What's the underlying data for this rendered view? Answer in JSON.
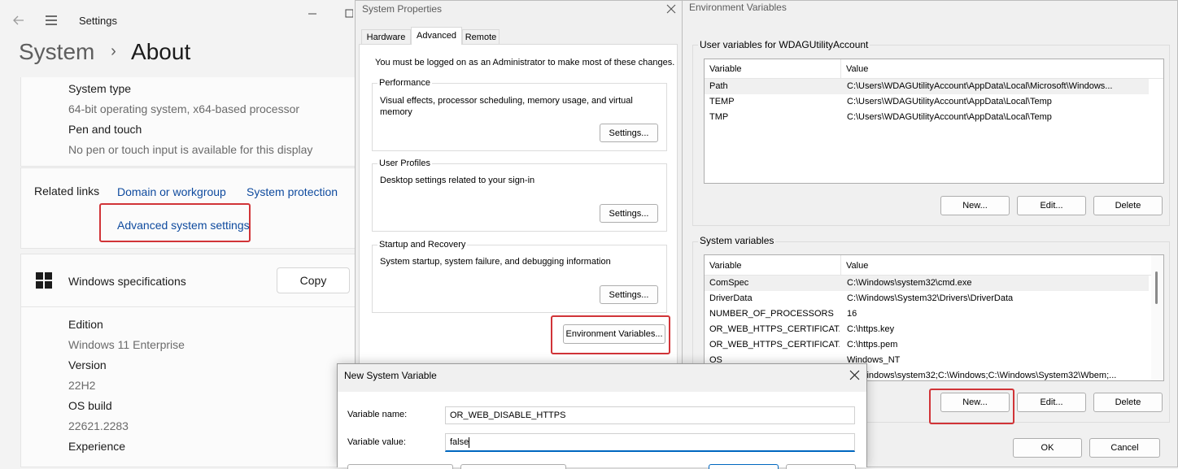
{
  "settings": {
    "app_title": "Settings",
    "breadcrumb_parent": "System",
    "breadcrumb_sep": "›",
    "breadcrumb_current": "About",
    "system_type_label": "System type",
    "system_type_value": "64-bit operating system, x64-based processor",
    "pen_touch_label": "Pen and touch",
    "pen_touch_value": "No pen or touch input is available for this display",
    "related_links_label": "Related links",
    "link_domain": "Domain or workgroup",
    "link_protection": "System protection",
    "link_advanced": "Advanced system settings",
    "win_spec_title": "Windows specifications",
    "copy_label": "Copy",
    "edition_label": "Edition",
    "edition_value": "Windows 11 Enterprise",
    "version_label": "Version",
    "version_value": "22H2",
    "osbuild_label": "OS build",
    "osbuild_value": "22621.2283",
    "experience_label": "Experience"
  },
  "sysprops": {
    "title": "System Properties",
    "tabs": [
      "Hardware",
      "Advanced",
      "Remote"
    ],
    "admin_note": "You must be logged on as an Administrator to make most of these changes.",
    "perf_label": "Performance",
    "perf_desc": "Visual effects, processor scheduling, memory usage, and virtual memory",
    "profiles_label": "User Profiles",
    "profiles_desc": "Desktop settings related to your sign-in",
    "startup_label": "Startup and Recovery",
    "startup_desc": "System startup, system failure, and debugging information",
    "settings_btn": "Settings...",
    "env_btn": "Environment Variables..."
  },
  "envvars": {
    "title": "Environment Variables",
    "user_group": "User variables for WDAGUtilityAccount",
    "col_variable": "Variable",
    "col_value": "Value",
    "user_rows": [
      {
        "name": "Path",
        "value": "C:\\Users\\WDAGUtilityAccount\\AppData\\Local\\Microsoft\\Windows..."
      },
      {
        "name": "TEMP",
        "value": "C:\\Users\\WDAGUtilityAccount\\AppData\\Local\\Temp"
      },
      {
        "name": "TMP",
        "value": "C:\\Users\\WDAGUtilityAccount\\AppData\\Local\\Temp"
      }
    ],
    "system_group": "System variables",
    "system_rows": [
      {
        "name": "ComSpec",
        "value": "C:\\Windows\\system32\\cmd.exe"
      },
      {
        "name": "DriverData",
        "value": "C:\\Windows\\System32\\Drivers\\DriverData"
      },
      {
        "name": "NUMBER_OF_PROCESSORS",
        "value": "16"
      },
      {
        "name": "OR_WEB_HTTPS_CERTIFICAT...",
        "value": "C:\\https.key"
      },
      {
        "name": "OR_WEB_HTTPS_CERTIFICAT...",
        "value": "C:\\https.pem"
      },
      {
        "name": "OS",
        "value": "Windows_NT"
      },
      {
        "name": "",
        "value": "C:\\Windows\\system32;C:\\Windows;C:\\Windows\\System32\\Wbem;..."
      }
    ],
    "new_btn": "New...",
    "edit_btn": "Edit...",
    "delete_btn": "Delete",
    "ok_btn": "OK",
    "cancel_btn": "Cancel"
  },
  "newvar": {
    "title": "New System Variable",
    "name_label": "Variable name:",
    "name_value": "OR_WEB_DISABLE_HTTPS",
    "value_label": "Variable value:",
    "value_value": "false"
  },
  "colors": {
    "highlight_red": "#d13438",
    "link_blue": "#0e4a9e",
    "focus_blue": "#0067c0"
  }
}
